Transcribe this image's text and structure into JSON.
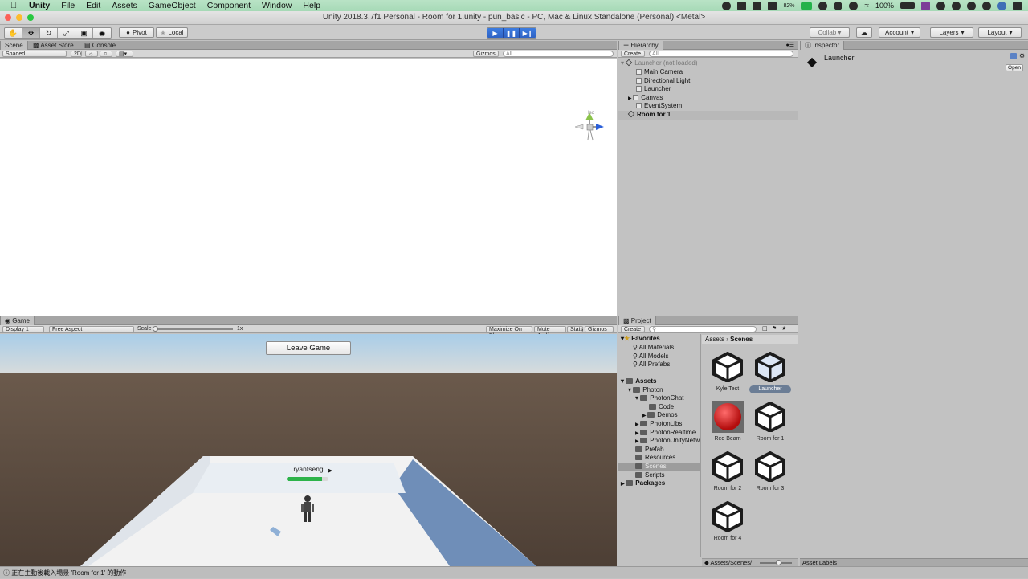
{
  "menubar": {
    "app": "Unity",
    "items": [
      "File",
      "Edit",
      "Assets",
      "GameObject",
      "Component",
      "Window",
      "Help"
    ],
    "status_battery": "100%",
    "network_percent": "82%"
  },
  "window": {
    "title": "Unity 2018.3.7f1 Personal - Room for 1.unity - pun_basic - PC, Mac & Linux Standalone (Personal) <Metal>"
  },
  "toolbar": {
    "pivot": "Pivot",
    "local": "Local",
    "collab": "Collab ▾",
    "account": "Account",
    "layers": "Layers",
    "layout": "Layout"
  },
  "scene_panel": {
    "tabs": [
      "Scene",
      "Asset Store",
      "Console"
    ],
    "shading": "Shaded",
    "mode_2d": "2D",
    "gizmos": "Gizmos",
    "search_placeholder": "All",
    "gizmo_label": "Iso"
  },
  "game_panel": {
    "tab": "Game",
    "display": "Display 1",
    "aspect": "Free Aspect",
    "scale_label": "Scale",
    "scale_value": "1x",
    "maximize": "Maximize On Play",
    "mute": "Mute Audio",
    "stats": "Stats",
    "gizmos": "Gizmos",
    "leave_button": "Leave Game",
    "player_name": "ryantseng",
    "health": 0.85,
    "colors": {
      "health": "#2db34a",
      "sky": "#cfe0ec",
      "ground": "#5b4c40"
    }
  },
  "hierarchy": {
    "tab": "Hierarchy",
    "create": "Create",
    "search_placeholder": "All",
    "scene1": "Launcher (not loaded)",
    "objects": [
      "Main Camera",
      "Directional Light",
      "Launcher",
      "Canvas",
      "EventSystem"
    ],
    "scene2": "Room for 1"
  },
  "inspector": {
    "tab": "Inspector",
    "object": "Launcher",
    "open": "Open",
    "asset_labels": "Asset Labels"
  },
  "project": {
    "tab": "Project",
    "create": "Create",
    "favorites": "Favorites",
    "fav_items": [
      "All Materials",
      "All Models",
      "All Prefabs"
    ],
    "assets_root": "Assets",
    "tree": [
      "Photon",
      "PhotonChat",
      "Code",
      "Demos",
      "PhotonLibs",
      "PhotonRealtime",
      "PhotonUnityNetw",
      "Prefab",
      "Resources",
      "Scenes",
      "Scripts"
    ],
    "packages": "Packages",
    "breadcrumb": [
      "Assets",
      "Scenes"
    ],
    "assets": [
      "Kyle Test",
      "Launcher",
      "Red Beam",
      "Room for 1",
      "Room for 2",
      "Room for 3",
      "Room for 4"
    ],
    "footer_path": "Assets/Scenes/"
  },
  "status": {
    "message": "正在主動後載入場景 'Room for 1' 的動作"
  }
}
